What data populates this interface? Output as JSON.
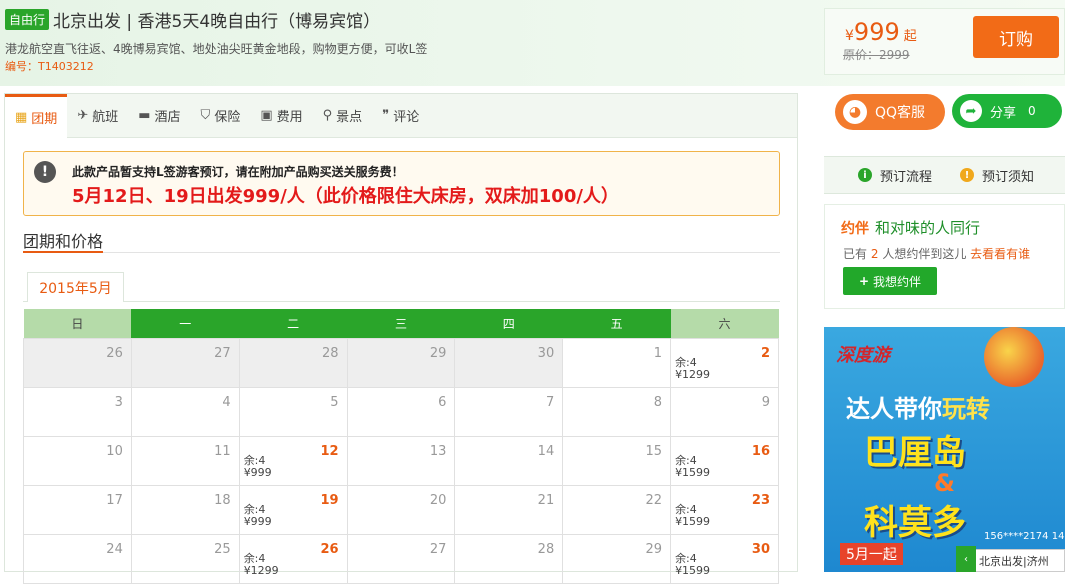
{
  "header": {
    "tag": "自由行",
    "title": "北京出发 | 香港5天4晚自由行（博易宾馆）",
    "subtitle": "港龙航空直飞往返、4晚博易宾馆、地处油尖旺黄金地段，购物更方便，可收L签",
    "code": "编号：T1403212"
  },
  "price_box": {
    "currency": "¥",
    "price": "999",
    "suffix": "起",
    "original": "原价：2999",
    "order_label": "订购"
  },
  "social": {
    "qq_label": "QQ客服",
    "share_label": "分享",
    "share_count": "0"
  },
  "booking": {
    "process_label": "预订流程",
    "notice_label": "预订须知"
  },
  "companion": {
    "logo": "约伴",
    "title": "和对味的人同行",
    "line_prefix": "已有",
    "count": "2",
    "line_middle": "人想约伴到这儿",
    "go_link": "去看看有谁",
    "want_button": "我想约伴"
  },
  "ad": {
    "brand": "深度游",
    "line1a": "达人带你",
    "line1b": "玩转",
    "line2": "巴厘岛",
    "amp": "&",
    "line3": "科莫多",
    "date": "5月一起",
    "phone": "156****2174 14",
    "footer_text": "北京出发|济州"
  },
  "tabs": [
    {
      "label": "团期",
      "icon": "calendar-icon",
      "glyph": "▦"
    },
    {
      "label": "航班",
      "icon": "plane-icon",
      "glyph": "✈"
    },
    {
      "label": "酒店",
      "icon": "bed-icon",
      "glyph": "▬"
    },
    {
      "label": "保险",
      "icon": "shield-icon",
      "glyph": "⛉"
    },
    {
      "label": "费用",
      "icon": "wallet-icon",
      "glyph": "▣"
    },
    {
      "label": "景点",
      "icon": "map-pin-icon",
      "glyph": "⚲"
    },
    {
      "label": "评论",
      "icon": "comment-icon",
      "glyph": "❞"
    }
  ],
  "notice": {
    "line1": "此款产品暂支持L签游客预订，请在附加产品购买送关服务费！",
    "line2": "5月12日、19日出发999/人（此价格限住大床房，双床加100/人）"
  },
  "section_title": "团期和价格",
  "month_tab": "2015年5月",
  "calendar": {
    "weekdays": [
      "日",
      "一",
      "二",
      "三",
      "四",
      "五",
      "六"
    ],
    "weeks": [
      [
        {
          "day": "26",
          "past": true
        },
        {
          "day": "27",
          "past": true
        },
        {
          "day": "28",
          "past": true
        },
        {
          "day": "29",
          "past": true
        },
        {
          "day": "30",
          "past": true
        },
        {
          "day": "1"
        },
        {
          "day": "2",
          "avail": true,
          "rem": "余:4",
          "price": "¥1299"
        }
      ],
      [
        {
          "day": "3"
        },
        {
          "day": "4"
        },
        {
          "day": "5"
        },
        {
          "day": "6"
        },
        {
          "day": "7"
        },
        {
          "day": "8"
        },
        {
          "day": "9"
        }
      ],
      [
        {
          "day": "10"
        },
        {
          "day": "11"
        },
        {
          "day": "12",
          "avail": true,
          "rem": "余:4",
          "price": "¥999"
        },
        {
          "day": "13"
        },
        {
          "day": "14"
        },
        {
          "day": "15"
        },
        {
          "day": "16",
          "avail": true,
          "rem": "余:4",
          "price": "¥1599"
        }
      ],
      [
        {
          "day": "17"
        },
        {
          "day": "18"
        },
        {
          "day": "19",
          "avail": true,
          "rem": "余:4",
          "price": "¥999"
        },
        {
          "day": "20"
        },
        {
          "day": "21"
        },
        {
          "day": "22"
        },
        {
          "day": "23",
          "avail": true,
          "rem": "余:4",
          "price": "¥1599"
        }
      ],
      [
        {
          "day": "24"
        },
        {
          "day": "25"
        },
        {
          "day": "26",
          "avail": true,
          "rem": "余:4",
          "price": "¥1299"
        },
        {
          "day": "27"
        },
        {
          "day": "28"
        },
        {
          "day": "29"
        },
        {
          "day": "30",
          "avail": true,
          "rem": "余:4",
          "price": "¥1599"
        }
      ]
    ]
  },
  "colors": {
    "accent_orange": "#e85b12",
    "brand_green": "#2aa52a",
    "alert_red": "#e31a1a"
  }
}
